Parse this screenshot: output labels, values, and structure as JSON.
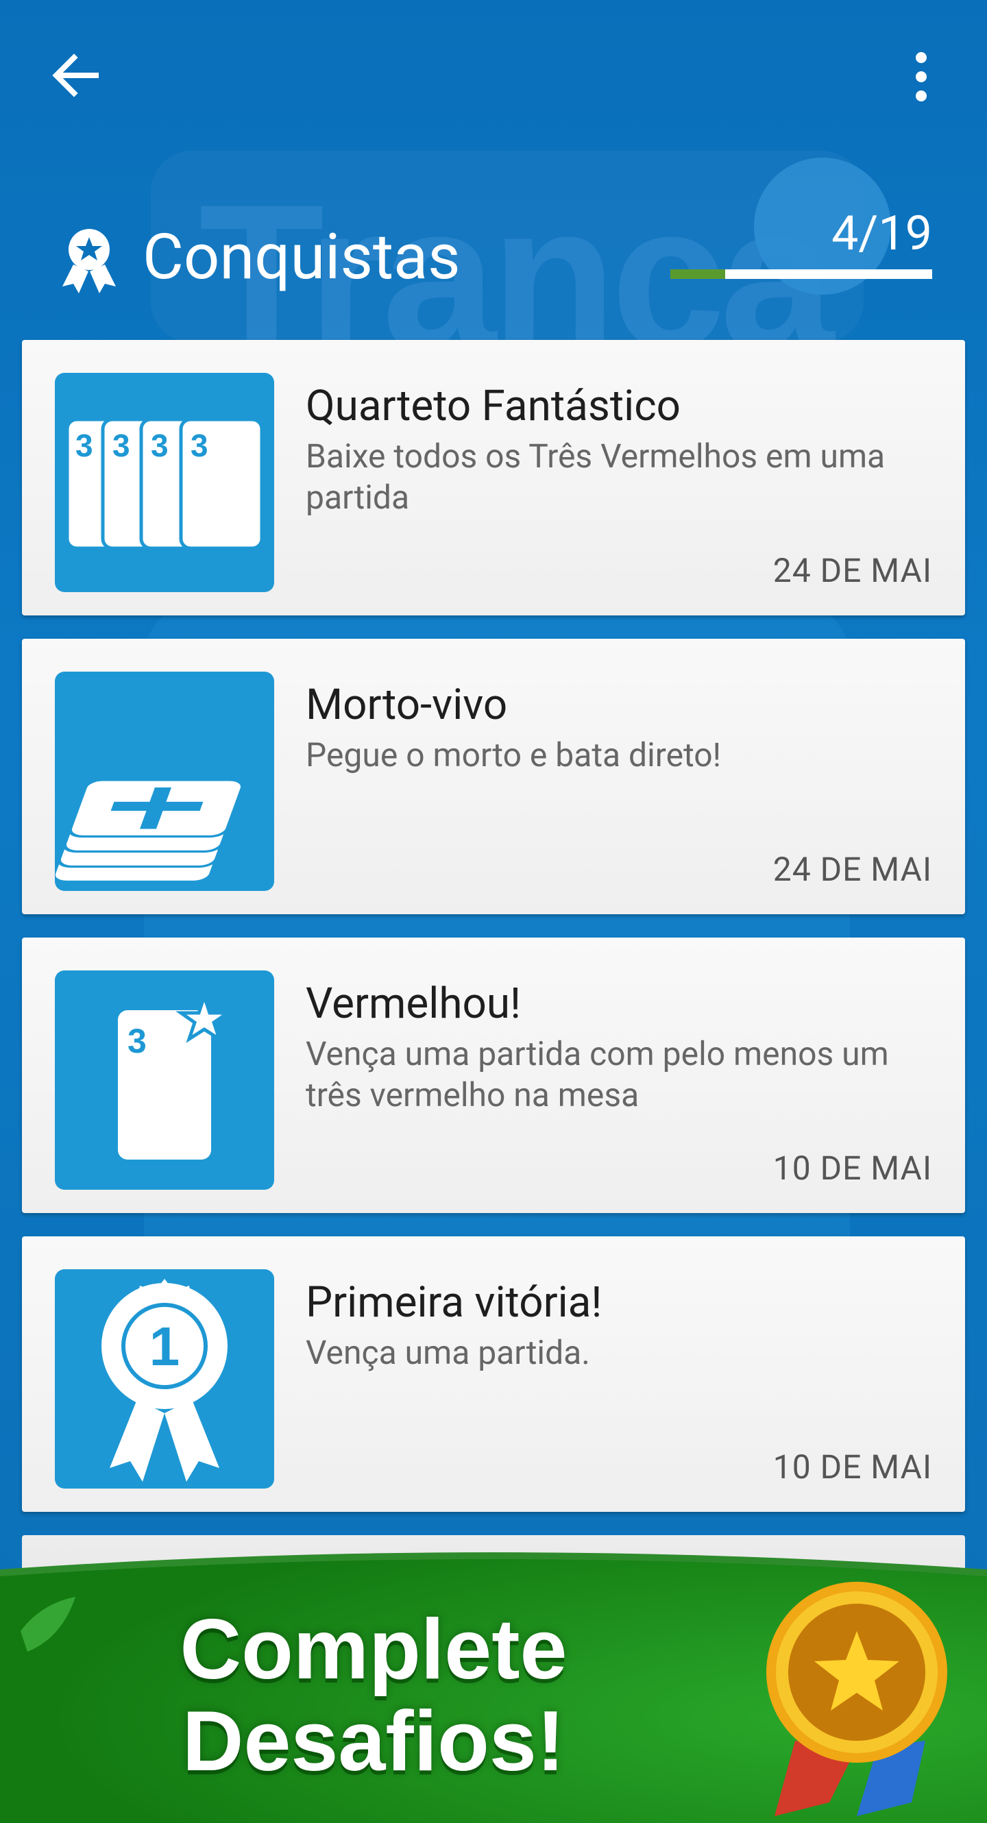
{
  "topbar": {
    "back_icon": "arrow-left-icon",
    "menu_icon": "more-vert-icon"
  },
  "header": {
    "title": "Conquistas",
    "progress_text": "4/19",
    "progress_value": 0.2105,
    "icon": "award-icon"
  },
  "background": {
    "logo_text": "Tranca"
  },
  "achievements": [
    {
      "title": "Quarteto Fantástico",
      "description": "Baixe todos os Três Vermelhos em uma partida",
      "date": "24 DE MAI",
      "icon": "four-cards-icon",
      "card_label": "3"
    },
    {
      "title": "Morto-vivo",
      "description": "Pegue o morto e bata direto!",
      "date": "24 DE MAI",
      "icon": "card-stack-cross-icon"
    },
    {
      "title": "Vermelhou!",
      "description": "Vença uma partida com pelo menos um três vermelho na mesa",
      "date": "10 DE MAI",
      "icon": "card-star-icon",
      "card_label": "3"
    },
    {
      "title": "Primeira vitória!",
      "description": "Vença uma partida.",
      "date": "10 DE MAI",
      "icon": "ribbon-medal-icon",
      "medal_number": "1"
    }
  ],
  "banner": {
    "line1": "Complete",
    "line2": "Desafios!",
    "icon": "star-medal-icon"
  },
  "colors": {
    "background": "#0b72bc",
    "tile": "#1e98d4",
    "progress_fill": "#5a9b2e",
    "banner_green": "#1e8d1a"
  }
}
